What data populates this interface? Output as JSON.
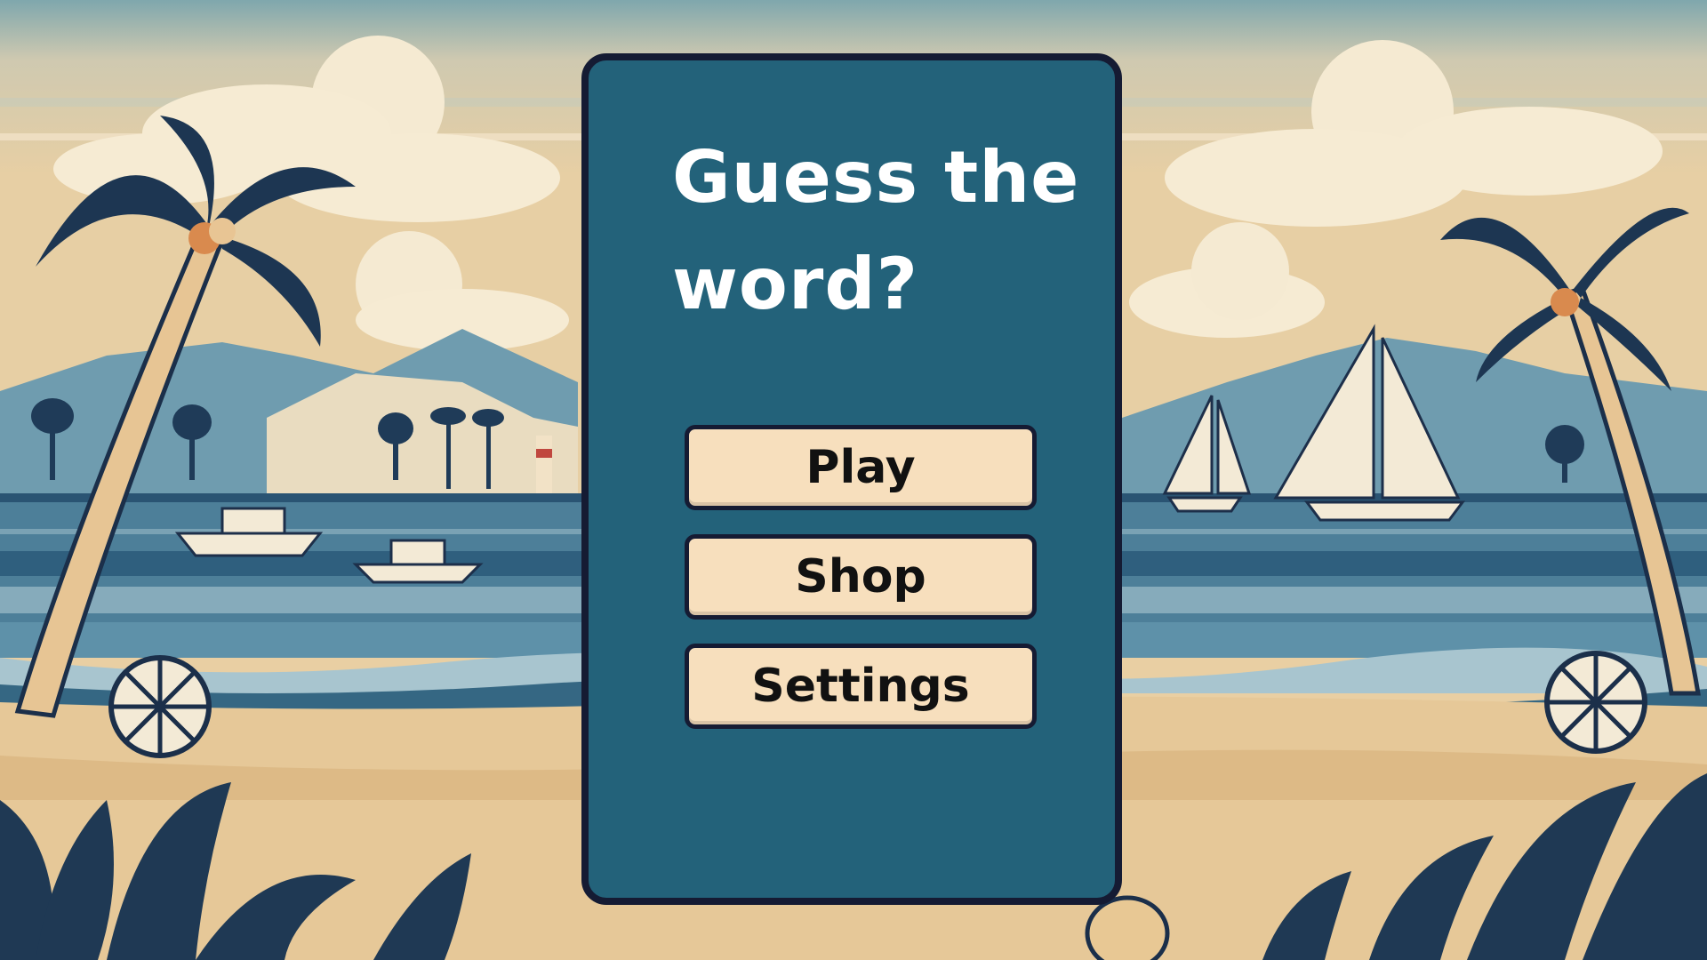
{
  "game": {
    "title": "Guess the word?"
  },
  "menu": {
    "buttons": [
      {
        "id": "play",
        "label": "Play"
      },
      {
        "id": "shop",
        "label": "Shop"
      },
      {
        "id": "settings",
        "label": "Settings"
      }
    ]
  },
  "colors": {
    "panel": "#23627a",
    "panel_border": "#151b33",
    "button_fill": "#f7dfbd",
    "button_text": "#111111",
    "title_text": "#ffffff",
    "sky": "#dfc9a0",
    "sea": "#4b7f9a",
    "sand": "#e9cfa3",
    "foliage": "#1e3a55"
  },
  "background": {
    "theme": "beach",
    "icons": [
      "palm-tree-icon",
      "sailboat-icon",
      "motorboat-icon",
      "beach-ball-icon",
      "mountain-icon",
      "cloud-icon",
      "sun-icon",
      "lighthouse-icon",
      "fern-icon"
    ]
  }
}
